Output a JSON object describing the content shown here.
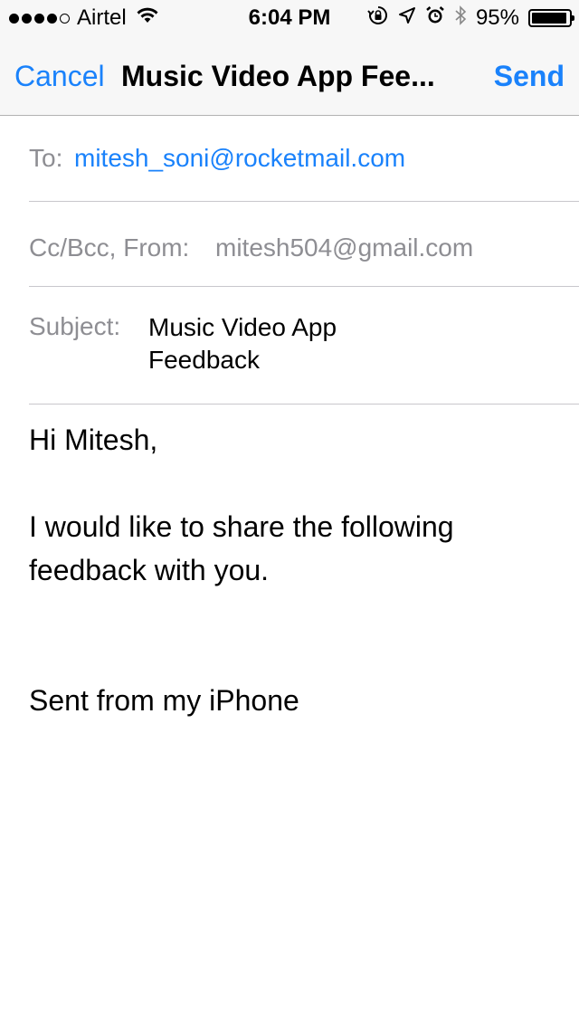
{
  "status_bar": {
    "carrier": "Airtel",
    "time": "6:04 PM",
    "battery_percent": "95%",
    "battery_level": 0.95,
    "signal_bars_filled": 4,
    "signal_bars_total": 5
  },
  "nav": {
    "cancel_label": "Cancel",
    "title": "Music Video App Fee...",
    "send_label": "Send"
  },
  "compose": {
    "to_label": "To:",
    "to_value": "mitesh_soni@rocketmail.com",
    "cc_label": "Cc/Bcc, From:",
    "from_value": "mitesh504@gmail.com",
    "subject_label": "Subject:",
    "subject_value": "Music Video App Feedback",
    "body": {
      "greeting": "Hi Mitesh,",
      "message": "I would like to share the following feedback with you.",
      "signature": "Sent from my iPhone"
    }
  },
  "colors": {
    "accent": "#1a82fb",
    "label_gray": "#8e8e93",
    "bar_background": "#f7f7f7"
  },
  "icons": [
    "wifi-icon",
    "rotation-lock-icon",
    "location-icon",
    "alarm-icon",
    "bluetooth-icon",
    "battery-icon"
  ]
}
